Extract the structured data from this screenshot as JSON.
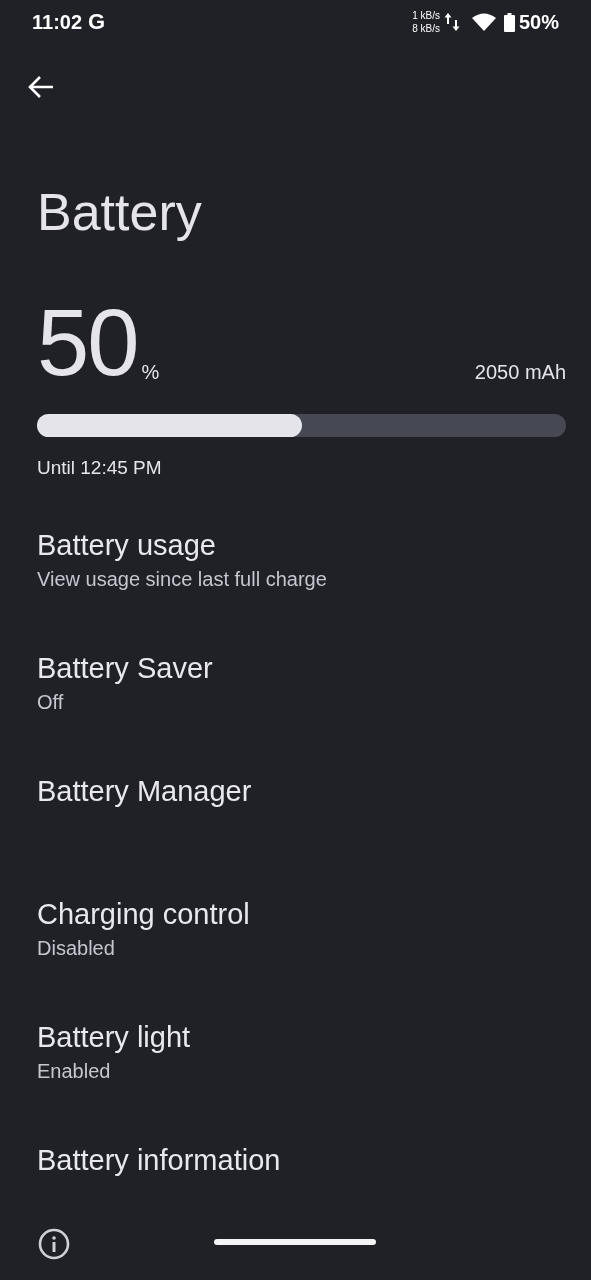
{
  "status_bar": {
    "time": "11:02",
    "carrier_mark": "G",
    "speed_up": "1 kB/s",
    "speed_down": "8 kB/s",
    "battery_text": "50%"
  },
  "title": "Battery",
  "summary": {
    "percent": "50",
    "percent_sign": "%",
    "capacity": "2050 mAh",
    "level": 0.5,
    "estimate": "Until 12:45 PM"
  },
  "items": [
    {
      "title": "Battery usage",
      "subtitle": "View usage since last full charge"
    },
    {
      "title": "Battery Saver",
      "subtitle": "Off"
    },
    {
      "title": "Battery Manager"
    },
    {
      "title": "Charging control",
      "subtitle": "Disabled"
    },
    {
      "title": "Battery light",
      "subtitle": "Enabled"
    },
    {
      "title": "Battery information"
    }
  ]
}
